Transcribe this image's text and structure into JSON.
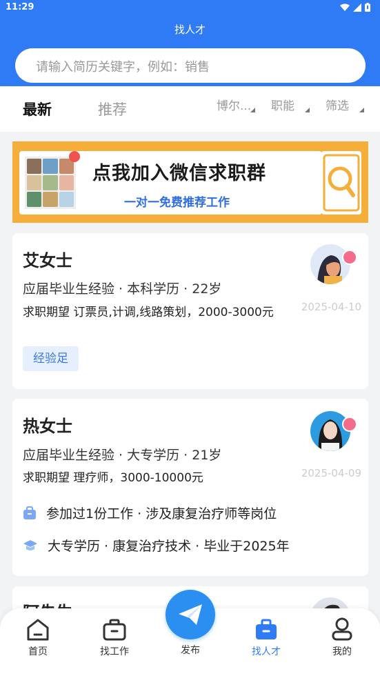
{
  "status": {
    "time": "11:29"
  },
  "header": {
    "title": "找人才"
  },
  "search": {
    "placeholder": "请输入简历关键字，例如：销售"
  },
  "tabs": {
    "latest": "最新",
    "recommend": "推荐"
  },
  "filters": {
    "location": "博尔...",
    "function": "职能",
    "filter": "筛选"
  },
  "banner": {
    "title": "点我加入微信求职群",
    "subtitle": "一对一免费推荐工作"
  },
  "cards": [
    {
      "name": "艾女士",
      "meta": "应届毕业生经验 · 本科学历 · 22岁",
      "expect": "求职期望 订票员,计调,线路策划，2000-3000元",
      "date": "2025-04-10",
      "tag": "经验足"
    },
    {
      "name": "热女士",
      "meta": "应届毕业生经验 · 大专学历 · 21岁",
      "expect": "求职期望 理疗师，3000-10000元",
      "date": "2025-04-09",
      "work": "参加过1份工作 · 涉及康复治疗师等岗位",
      "edu": "大专学历 · 康复治疗技术 · 毕业于2025年"
    },
    {
      "name": "阿先生"
    }
  ],
  "tabbar": {
    "home": "首页",
    "find_job": "找工作",
    "publish": "发布",
    "find_talent": "找人才",
    "mine": "我的"
  },
  "colors": {
    "primary": "#2f7bf6",
    "banner": "#f6ae3a",
    "badge": "#f36d8b"
  }
}
